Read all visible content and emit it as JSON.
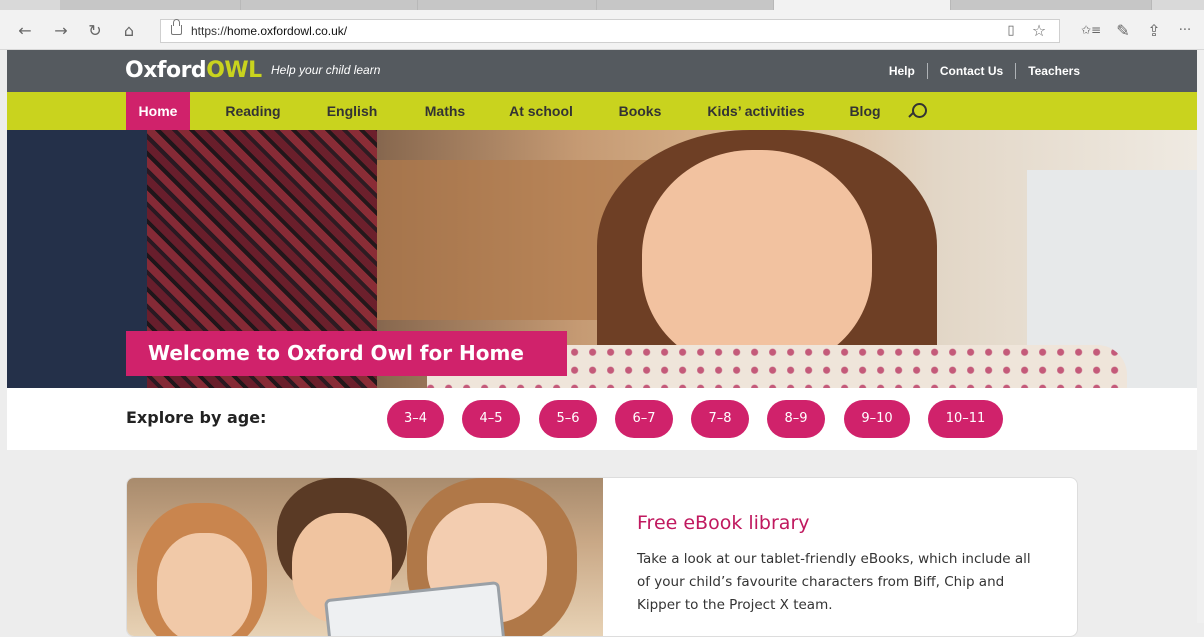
{
  "browser": {
    "url_prefix": "https://",
    "url_host": "home.oxfordowl.co.uk/",
    "icons": {
      "back": "back-arrow-icon",
      "forward": "forward-arrow-icon",
      "refresh": "refresh-icon",
      "home": "home-icon",
      "reading_view": "reading-view-icon",
      "favorite": "star-icon",
      "favorites_list": "favorites-list-icon",
      "pen": "pen-icon",
      "share": "share-icon",
      "more": "more-icon"
    },
    "glyphs": {
      "back": "←",
      "forward": "→",
      "refresh": "↻",
      "home": "⌂",
      "reading_view": "▯",
      "favorite": "☆",
      "favorites_list": "✩≡",
      "pen": "✎",
      "share": "⇪",
      "more": "···"
    }
  },
  "site": {
    "logo_main": "Oxford",
    "logo_owl": "OWL",
    "tagline": "Help your child learn",
    "top_links": [
      "Help",
      "Contact Us",
      "Teachers"
    ],
    "nav": [
      "Home",
      "Reading",
      "English",
      "Maths",
      "At school",
      "Books",
      "Kids’ activities",
      "Blog"
    ],
    "active_nav": "Home",
    "colors": {
      "brand_pink": "#d0226b",
      "brand_lime": "#c9d31e",
      "header_grey": "#555a5f"
    }
  },
  "hero": {
    "welcome": "Welcome to Oxford Owl for Home"
  },
  "explore": {
    "label": "Explore by age:",
    "ages": [
      "3–4",
      "4–5",
      "5–6",
      "6–7",
      "7–8",
      "8–9",
      "9–10",
      "10–11"
    ]
  },
  "card": {
    "title": "Free eBook library",
    "description": "Take a look at our tablet-friendly eBooks, which include all of your child’s favourite characters from Biff, Chip and Kipper to the Project X team."
  }
}
